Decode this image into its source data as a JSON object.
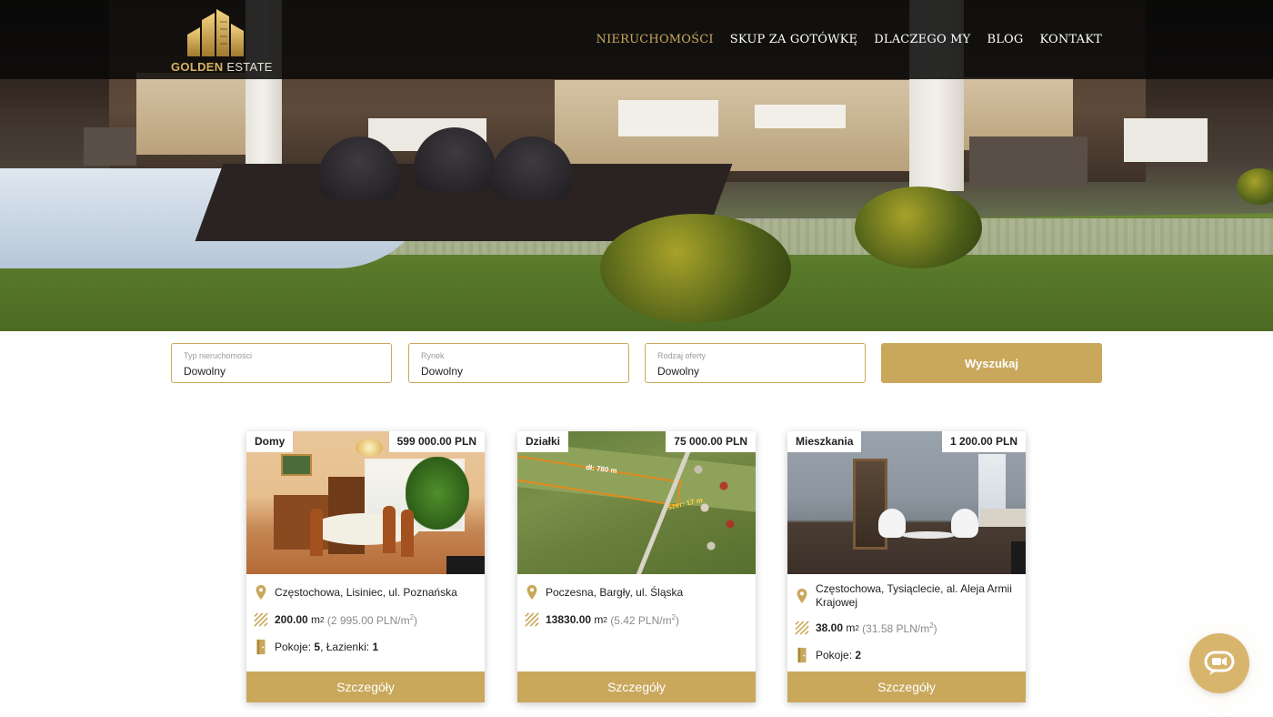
{
  "brand": {
    "logo_bold": "GOLDEN",
    "logo_light": "ESTATE",
    "accent": "#c9a85c"
  },
  "nav": [
    {
      "label": "NIERUCHOMOŚCI",
      "active": true
    },
    {
      "label": "SKUP ZA GOTÓWKĘ",
      "active": false
    },
    {
      "label": "DLACZEGO MY",
      "active": false
    },
    {
      "label": "BLOG",
      "active": false
    },
    {
      "label": "KONTAKT",
      "active": false
    }
  ],
  "search": {
    "fields": [
      {
        "label": "Typ nieruchomości",
        "value": "Dowolny"
      },
      {
        "label": "Rynek",
        "value": "Dowolny"
      },
      {
        "label": "Rodzaj oferty",
        "value": "Dowolny"
      }
    ],
    "button": "Wyszukaj"
  },
  "listings": [
    {
      "category": "Domy",
      "price": "599 000.00 PLN",
      "address": "Częstochowa, Lisiniec, ul. Poznańska",
      "area": "200.00",
      "area_unit": "m",
      "price_per_m2": "(2 995.00 PLN/m",
      "price_per_m2_end": ")",
      "rooms_label": "Pokoje:",
      "rooms": "5",
      "bath_label": "Łazienki:",
      "baths": "1",
      "details": "Szczegóły"
    },
    {
      "category": "Działki",
      "price": "75 000.00 PLN",
      "address": "Poczesna, Bargły, ul. Śląska",
      "area": "13830.00",
      "area_unit": "m",
      "price_per_m2": "(5.42 PLN/m",
      "price_per_m2_end": ")",
      "photo_label_1": "dł: 780 m",
      "photo_label_2": "szer: 17 m",
      "details": "Szczegóły"
    },
    {
      "category": "Mieszkania",
      "price": "1 200.00 PLN",
      "address": "Częstochowa, Tysiąclecie, al. Aleja Armii Krajowej",
      "area": "38.00",
      "area_unit": "m",
      "price_per_m2": "(31.58 PLN/m",
      "price_per_m2_end": ")",
      "rooms_label": "Pokoje:",
      "rooms": "2",
      "details": "Szczegóły"
    }
  ],
  "superscript_2": "2",
  "chat": {
    "icon": "chat-bubble-icon"
  }
}
